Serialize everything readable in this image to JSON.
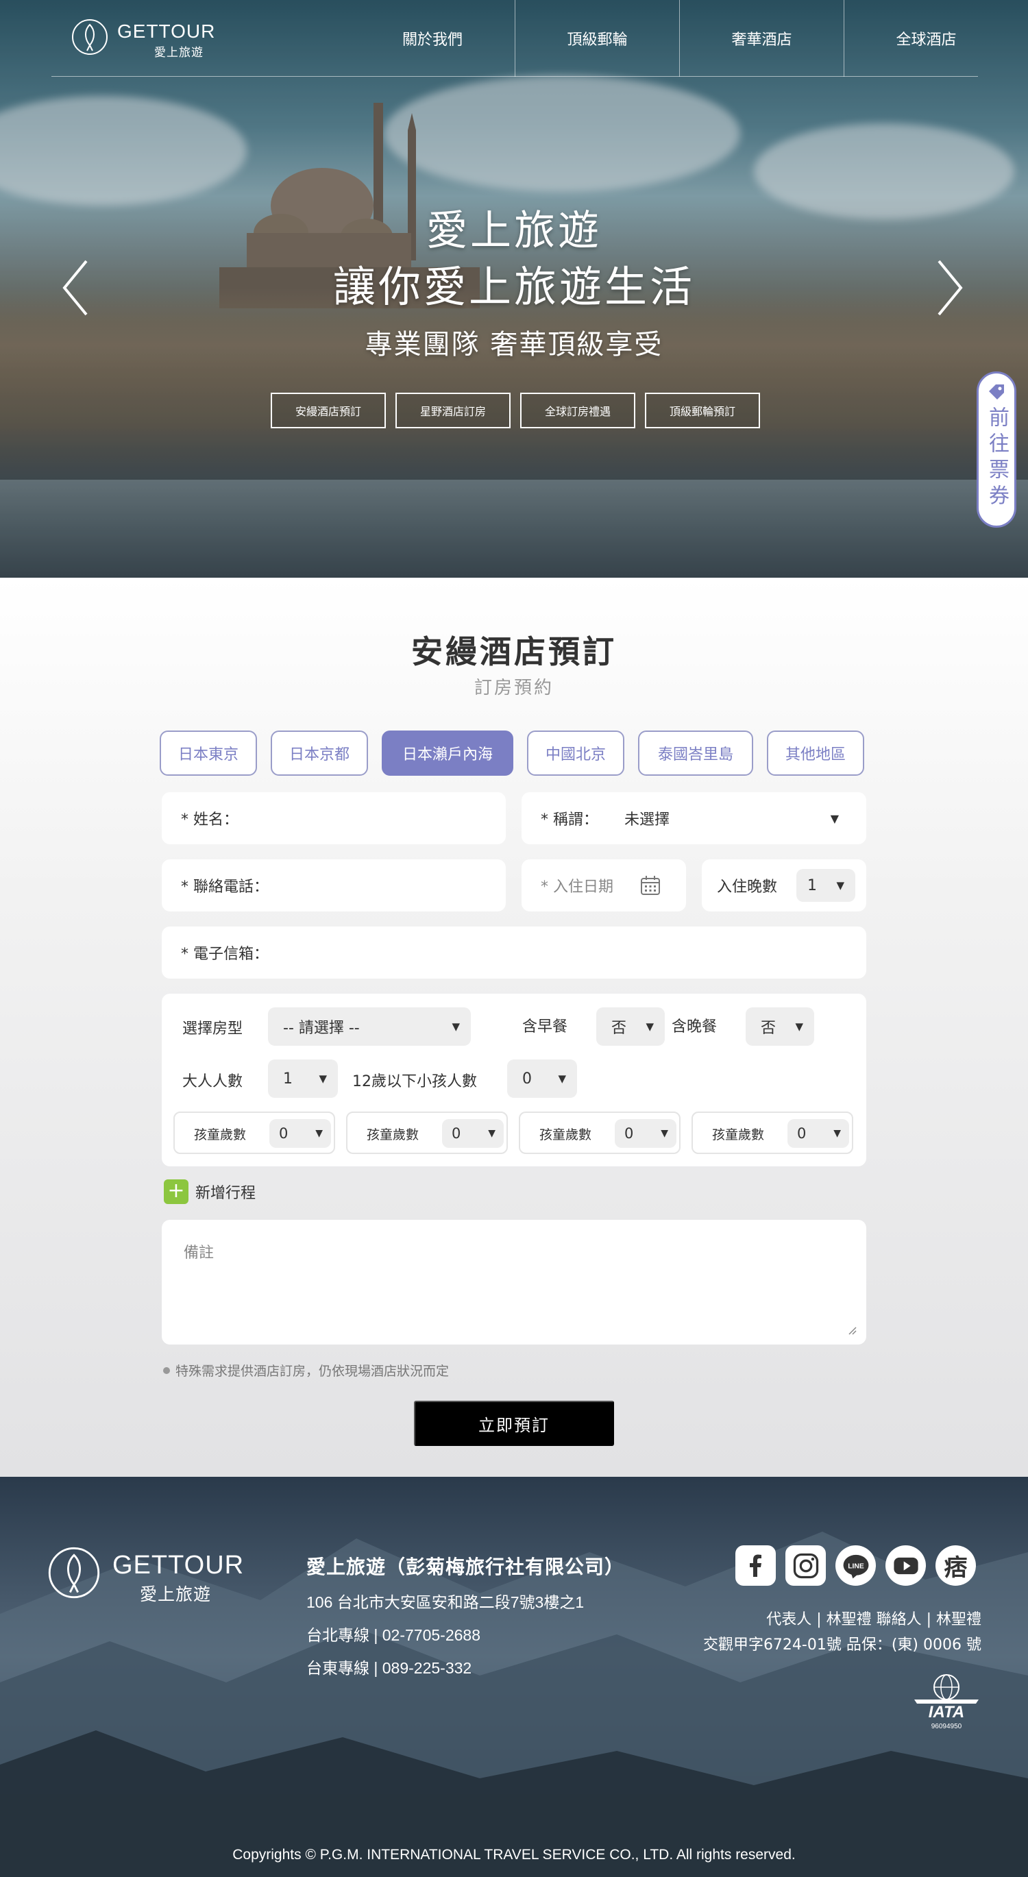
{
  "brand": {
    "logo_en": "GETTOUR",
    "logo_zh": "愛上旅遊"
  },
  "nav": {
    "items": [
      "關於我們",
      "頂級郵輪",
      "奢華酒店",
      "全球酒店"
    ]
  },
  "hero": {
    "line1": "愛上旅遊",
    "line2": "讓你愛上旅遊生活",
    "line3": "專業團隊 奢華頂級享受",
    "buttons": [
      "安縵酒店預訂",
      "星野酒店訂房",
      "全球訂房禮遇",
      "頂級郵輪預訂"
    ],
    "ticket_tab": "前往票券"
  },
  "booking": {
    "title": "安縵酒店預訂",
    "subtitle": "訂房預約",
    "regions": [
      {
        "label": "日本東京",
        "active": false
      },
      {
        "label": "日本京都",
        "active": false
      },
      {
        "label": "日本瀨戶內海",
        "active": true
      },
      {
        "label": "中國北京",
        "active": false
      },
      {
        "label": "泰國峇里島",
        "active": false
      },
      {
        "label": "其他地區",
        "active": false
      }
    ],
    "name_label": "* 姓名：",
    "title_label": "* 稱謂：",
    "title_value": "未選擇",
    "phone_label": "* 聯絡電話：",
    "checkin_placeholder": "* 入住日期",
    "nights_label": "入住晚數",
    "nights_value": "1",
    "email_label": "* 電子信箱：",
    "room_type_label": "選擇房型",
    "room_type_value": "-- 請選擇 --",
    "breakfast_label": "含早餐",
    "breakfast_value": "否",
    "dinner_label": "含晚餐",
    "dinner_value": "否",
    "adults_label": "大人人數",
    "adults_value": "1",
    "children_label": "12歲以下小孩人數",
    "children_value": "0",
    "child_ages": [
      {
        "label": "孩童歲數",
        "value": "0"
      },
      {
        "label": "孩童歲數",
        "value": "0"
      },
      {
        "label": "孩童歲數",
        "value": "0"
      },
      {
        "label": "孩童歲數",
        "value": "0"
      }
    ],
    "add_trip": "新增行程",
    "notes_placeholder": "備註",
    "notice": "特殊需求提供酒店訂房，仍依現場酒店狀況而定",
    "submit": "立即預訂"
  },
  "footer": {
    "company": "愛上旅遊（彭菊梅旅行社有限公司）",
    "address": "106 台北市大安區安和路二段7號3樓之1",
    "taipei": "台北專線 | 02-7705-2688",
    "taitung": "台東專線 | 089-225-332",
    "rep_line": "代表人 | 林聖禮 聯絡人 | 林聖禮",
    "license_line": "交觀甲字6724-01號 品保：(東) 0006 號",
    "socials": [
      "facebook-icon",
      "instagram-icon",
      "line-icon",
      "youtube-icon",
      "痞"
    ],
    "iata_text": "IATA",
    "iata_code": "96094950",
    "copyright": "Copyrights © P.G.M. INTERNATIONAL TRAVEL SERVICE CO., LTD. All rights reserved."
  },
  "colors": {
    "accent": "#7b7fc4",
    "add_green": "#8cc63f",
    "submit_bg": "#000000"
  }
}
